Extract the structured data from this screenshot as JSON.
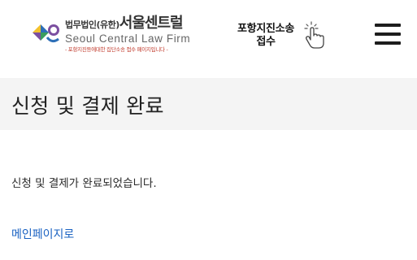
{
  "header": {
    "logo": {
      "name_small": "법무법인(유한)",
      "name_big": "서울센트럴",
      "name_en": "Seoul Central Law Firm",
      "tagline": "- 포항지진등에대한 집단소송 접수 페이지입니다 -",
      "mark_colors": {
        "yellow": "#f2c12e",
        "blue": "#2d6fb7",
        "purple": "#7b4fa0",
        "green": "#3a9d5d"
      }
    },
    "intake": {
      "line1": "포항지진소송",
      "line2": "접수"
    },
    "menu_icon": "hamburger-menu-icon",
    "pointer_icon": "hand-pointer-icon"
  },
  "page": {
    "title": "신청 및 결제 완료",
    "message": "신청 및 결제가 완료되었습니다.",
    "home_link": "메인페이지로"
  },
  "colors": {
    "title_bar_bg": "#f4f4f4",
    "link": "#1a62c2"
  }
}
